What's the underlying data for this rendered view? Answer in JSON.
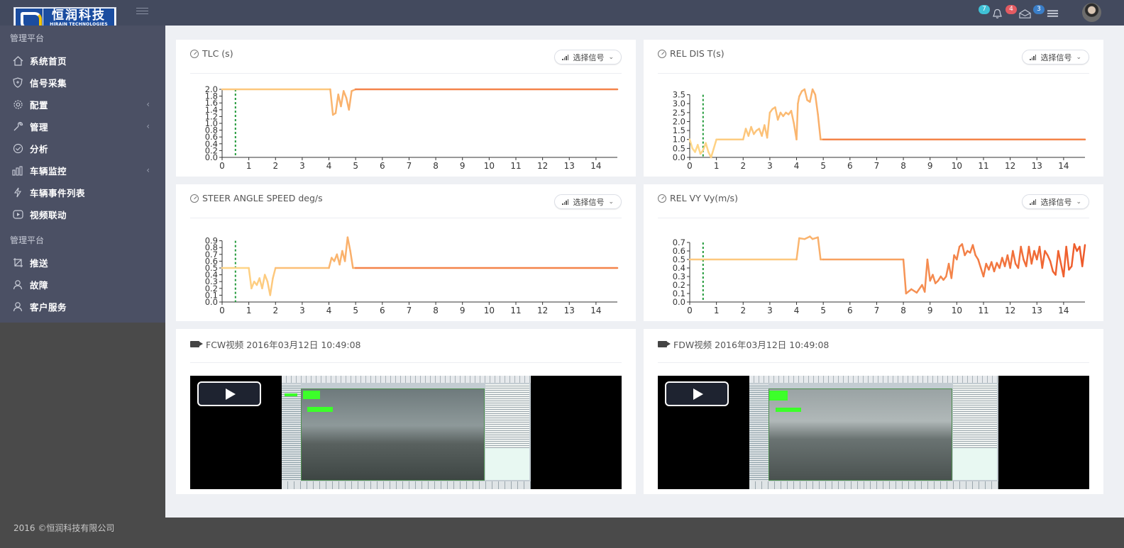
{
  "brand": {
    "name_cn": "恒润科技",
    "name_en": "HIRAIN TECHNOLOGIES"
  },
  "topbar": {
    "badges": [
      {
        "name": "notification-badge",
        "count": "7",
        "color": "#3fc1d6"
      },
      {
        "name": "alert-badge",
        "count": "4",
        "color": "#e45b62"
      },
      {
        "name": "message-badge",
        "count": "3",
        "color": "#3a7ec8"
      }
    ]
  },
  "sidebar": {
    "section1": "管理平台",
    "section2": "管理平台",
    "items": [
      {
        "label": "系统首页",
        "icon": "home-icon",
        "has_sub": false
      },
      {
        "label": "信号采集",
        "icon": "shield-icon",
        "has_sub": false
      },
      {
        "label": "配置",
        "icon": "gear-icon",
        "has_sub": true
      },
      {
        "label": "管理",
        "icon": "wrench-icon",
        "has_sub": true
      },
      {
        "label": "分析",
        "icon": "check-circle-icon",
        "has_sub": false
      },
      {
        "label": "车辆监控",
        "icon": "bar-chart-icon",
        "has_sub": true
      },
      {
        "label": "车辆事件列表",
        "icon": "bolt-icon",
        "has_sub": false
      },
      {
        "label": "视频联动",
        "icon": "play-icon",
        "has_sub": false
      },
      {
        "label": "推送",
        "icon": "crop-icon",
        "has_sub": false
      },
      {
        "label": "故障",
        "icon": "user-icon",
        "has_sub": false
      },
      {
        "label": "客户服务",
        "icon": "user-icon",
        "has_sub": false
      }
    ]
  },
  "footer": {
    "copyright": "2016 ©恒润科技有限公司"
  },
  "select_signal_label": "选择信号",
  "videos": [
    {
      "title": "FCW视频 2016年03月12日 10:49:08"
    },
    {
      "title": "FDW视频 2016年03月12日 10:49:08"
    }
  ],
  "colors": {
    "line_start": "#ffd98a",
    "line_end": "#ee5a2a",
    "marker": "#229a3a"
  },
  "chart_data": [
    {
      "type": "line",
      "title": "TLC (s)",
      "xlim": [
        0,
        14.8
      ],
      "ylim": [
        0,
        2.0
      ],
      "xticks": [
        0,
        1,
        2,
        3,
        4,
        5,
        6,
        7,
        8,
        9,
        10,
        11,
        12,
        13,
        14
      ],
      "yticks": [
        0,
        0.2,
        0.4,
        0.6,
        0.8,
        1.0,
        1.2,
        1.4,
        1.6,
        1.8,
        2.0
      ],
      "marker_x": 0.5,
      "x": [
        0,
        4.05,
        4.15,
        4.25,
        4.35,
        4.45,
        4.55,
        4.65,
        4.75,
        4.85,
        5.0,
        14.8
      ],
      "y": [
        2.0,
        2.0,
        1.25,
        1.3,
        1.85,
        1.5,
        1.95,
        1.75,
        1.4,
        1.95,
        2.0,
        2.0
      ]
    },
    {
      "type": "line",
      "title": "REL DIS T(s)",
      "xlim": [
        0,
        14.8
      ],
      "ylim": [
        0,
        3.8
      ],
      "xticks": [
        0,
        1,
        2,
        3,
        4,
        5,
        6,
        7,
        8,
        9,
        10,
        11,
        12,
        13,
        14
      ],
      "yticks": [
        0,
        0.5,
        1.0,
        1.5,
        2.0,
        2.5,
        3.0,
        3.5
      ],
      "marker_x": 0.5,
      "x": [
        0,
        0.1,
        0.2,
        0.3,
        0.4,
        0.5,
        0.6,
        0.7,
        0.8,
        0.9,
        1.0,
        1.1,
        2.0,
        2.1,
        2.2,
        2.3,
        2.4,
        2.5,
        2.6,
        2.7,
        2.8,
        2.9,
        3.0,
        3.1,
        3.2,
        3.3,
        3.4,
        3.5,
        3.6,
        3.7,
        3.8,
        3.9,
        4.0,
        4.05,
        4.1,
        4.2,
        4.3,
        4.4,
        4.5,
        4.6,
        4.7,
        4.8,
        4.9,
        5.0,
        14.8
      ],
      "y": [
        1.0,
        0.5,
        0.3,
        0.7,
        0.2,
        0.4,
        0.8,
        0.3,
        0.0,
        0.5,
        1.0,
        1.0,
        1.0,
        1.6,
        1.2,
        1.7,
        1.3,
        1.5,
        1.6,
        1.2,
        1.8,
        1.1,
        2.5,
        2.7,
        2.8,
        2.1,
        2.5,
        2.3,
        2.5,
        2.4,
        2.6,
        1.9,
        1.0,
        3.0,
        3.4,
        3.7,
        3.8,
        3.2,
        3.1,
        3.8,
        3.5,
        2.4,
        1.0,
        1.0,
        1.0
      ]
    },
    {
      "type": "line",
      "title": "STEER ANGLE SPEED deg/s",
      "xlim": [
        0,
        14.8
      ],
      "ylim": [
        0,
        1.0
      ],
      "xticks": [
        0,
        1,
        2,
        3,
        4,
        5,
        6,
        7,
        8,
        9,
        10,
        11,
        12,
        13,
        14
      ],
      "yticks": [
        0,
        0.1,
        0.2,
        0.3,
        0.4,
        0.5,
        0.6,
        0.7,
        0.8,
        0.9
      ],
      "marker_x": 0.5,
      "x": [
        0,
        1.0,
        1.1,
        1.2,
        1.3,
        1.4,
        1.5,
        1.6,
        1.7,
        1.8,
        1.9,
        2.0,
        4.0,
        4.1,
        4.2,
        4.3,
        4.4,
        4.5,
        4.6,
        4.7,
        4.8,
        4.9,
        5.0,
        14.8
      ],
      "y": [
        0.5,
        0.5,
        0.2,
        0.3,
        0.25,
        0.35,
        0.2,
        0.4,
        0.3,
        0.1,
        0.35,
        0.5,
        0.5,
        0.65,
        0.6,
        0.7,
        0.55,
        0.75,
        0.6,
        0.95,
        0.75,
        0.5,
        0.5,
        0.5
      ]
    },
    {
      "type": "line",
      "title": "REL VY Vy(m/s)",
      "xlim": [
        0,
        14.8
      ],
      "ylim": [
        0,
        0.8
      ],
      "xticks": [
        0,
        1,
        2,
        3,
        4,
        5,
        6,
        7,
        8,
        9,
        10,
        11,
        12,
        13,
        14
      ],
      "yticks": [
        0,
        0.1,
        0.2,
        0.3,
        0.4,
        0.5,
        0.6,
        0.7
      ],
      "marker_x": 0.5,
      "x": [
        0,
        4.0,
        4.1,
        4.3,
        4.5,
        4.6,
        4.8,
        4.9,
        5.0,
        8.0,
        8.1,
        8.3,
        8.5,
        8.7,
        8.8,
        8.9,
        9.0,
        9.1,
        9.2,
        9.3,
        9.4,
        9.5,
        9.6,
        9.7,
        9.8,
        9.9,
        10.0,
        10.1,
        10.2,
        10.3,
        10.4,
        10.5,
        10.6,
        10.7,
        10.8,
        10.9,
        11.0,
        11.1,
        11.2,
        11.3,
        11.4,
        11.5,
        11.6,
        11.7,
        11.8,
        11.9,
        12.0,
        12.1,
        12.2,
        12.3,
        12.4,
        12.5,
        12.6,
        12.7,
        12.8,
        12.9,
        13.0,
        13.1,
        13.2,
        13.3,
        13.4,
        13.5,
        13.6,
        13.7,
        13.8,
        13.9,
        14.0,
        14.1,
        14.2,
        14.3,
        14.4,
        14.5,
        14.6,
        14.7,
        14.8
      ],
      "y": [
        0.5,
        0.5,
        0.75,
        0.74,
        0.77,
        0.74,
        0.76,
        0.5,
        0.5,
        0.5,
        0.1,
        0.15,
        0.11,
        0.2,
        0.12,
        0.5,
        0.25,
        0.32,
        0.22,
        0.25,
        0.3,
        0.26,
        0.3,
        0.45,
        0.28,
        0.55,
        0.5,
        0.65,
        0.68,
        0.55,
        0.6,
        0.58,
        0.67,
        0.55,
        0.5,
        0.4,
        0.3,
        0.45,
        0.38,
        0.47,
        0.36,
        0.46,
        0.4,
        0.52,
        0.42,
        0.55,
        0.4,
        0.6,
        0.45,
        0.4,
        0.65,
        0.5,
        0.42,
        0.65,
        0.45,
        0.6,
        0.5,
        0.65,
        0.4,
        0.6,
        0.55,
        0.48,
        0.36,
        0.32,
        0.6,
        0.45,
        0.3,
        0.65,
        0.38,
        0.42,
        0.68,
        0.6,
        0.65,
        0.42,
        0.67
      ]
    }
  ]
}
